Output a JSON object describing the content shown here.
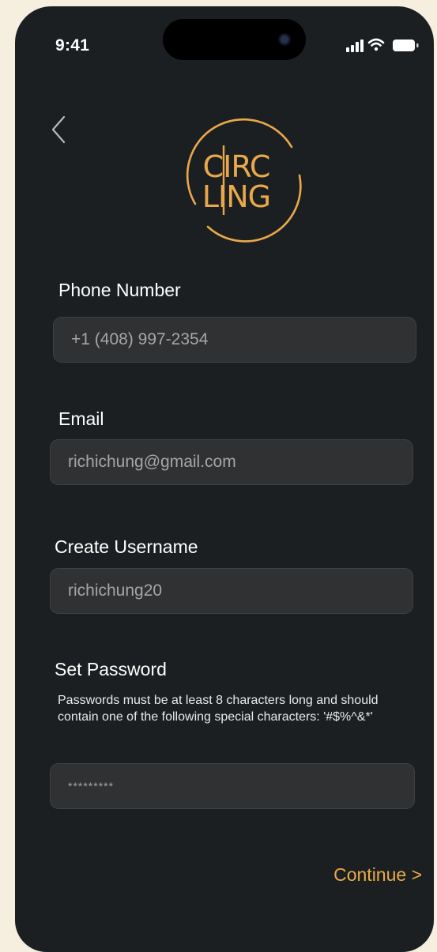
{
  "status_bar": {
    "time": "9:41"
  },
  "logo": {
    "line1": "CIRC",
    "line2": "LING",
    "color": "#e9a94a"
  },
  "form": {
    "phone": {
      "label": "Phone Number",
      "value": "+1 (408) 997-2354"
    },
    "email": {
      "label": "Email",
      "value": "richichung@gmail.com"
    },
    "username": {
      "label": "Create Username",
      "value": "richichung20"
    },
    "password": {
      "label": "Set Password",
      "helper": "Passwords must be at least 8 characters long and should contain one of the following special characters: '#$%^&*'",
      "value": "*********"
    }
  },
  "actions": {
    "continue_label": "Continue >"
  },
  "colors": {
    "background": "#1c1f21",
    "page": "#f6eedf",
    "field": "#2f3133",
    "accent": "#e9a94a"
  },
  "icons": [
    "signal-icon",
    "wifi-icon",
    "battery-icon",
    "back-chevron-icon"
  ]
}
